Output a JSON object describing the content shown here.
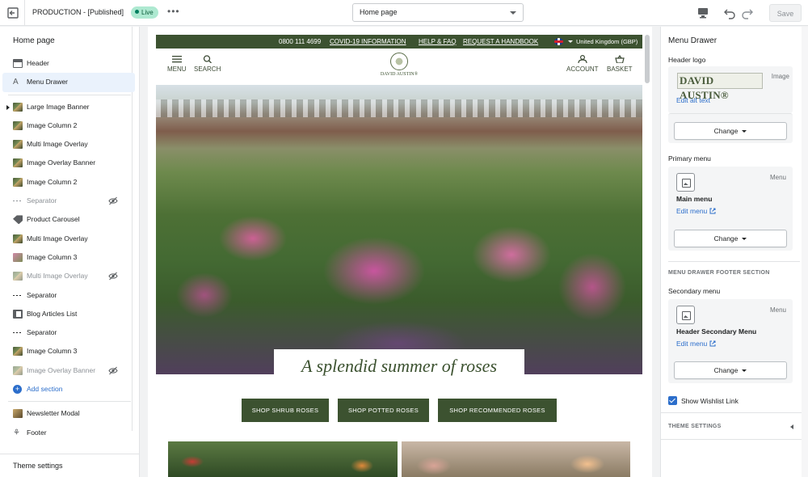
{
  "topbar": {
    "theme_title": "PRODUCTION - [Published]",
    "live_badge": "Live",
    "more": "•••",
    "page_select": "Home page",
    "save_label": "Save"
  },
  "left": {
    "title": "Home page",
    "items": [
      {
        "label": "Header"
      },
      {
        "label": "Menu Drawer"
      },
      {
        "label": "Large Image Banner"
      },
      {
        "label": "Image Column 2"
      },
      {
        "label": "Multi Image Overlay"
      },
      {
        "label": "Image Overlay Banner"
      },
      {
        "label": "Image Column 2"
      },
      {
        "label": "Separator"
      },
      {
        "label": "Product Carousel"
      },
      {
        "label": "Multi Image Overlay"
      },
      {
        "label": "Image Column 3"
      },
      {
        "label": "Multi Image Overlay"
      },
      {
        "label": "Separator"
      },
      {
        "label": "Blog Articles List"
      },
      {
        "label": "Separator"
      },
      {
        "label": "Image Column 3"
      },
      {
        "label": "Image Overlay Banner"
      }
    ],
    "add_section": "Add section",
    "bottom_items": [
      {
        "label": "Newsletter Modal"
      },
      {
        "label": "Footer"
      }
    ],
    "theme_settings": "Theme settings"
  },
  "preview": {
    "utility": {
      "phone": "0800 111 4699",
      "covid": "COVID-19 INFORMATION",
      "help": "HELP & FAQ",
      "handbook": "REQUEST A HANDBOOK",
      "region": "United Kingdom (GBP)"
    },
    "nav": {
      "menu": "MENU",
      "search": "SEARCH",
      "logo": "DAVID AUSTIN®",
      "account": "ACCOUNT",
      "basket": "BASKET"
    },
    "hero_title": "A splendid summer of roses",
    "buttons": [
      "SHOP SHRUB ROSES",
      "SHOP POTTED ROSES",
      "SHOP RECOMMENDED ROSES"
    ]
  },
  "right": {
    "title": "Menu Drawer",
    "header_logo_label": "Header logo",
    "logo_text": "DAVID AUSTIN®",
    "image_tag": "Image",
    "edit_alt": "Edit alt text",
    "change": "Change",
    "primary_menu_label": "Primary menu",
    "menu_tag": "Menu",
    "main_menu": "Main menu",
    "edit_menu": "Edit menu",
    "footer_section": "MENU DRAWER FOOTER SECTION",
    "secondary_menu_label": "Secondary menu",
    "secondary_menu": "Header Secondary Menu",
    "wishlist": "Show Wishlist Link",
    "theme_settings": "THEME SETTINGS"
  },
  "colors": {
    "brand_green": "#3c5230",
    "link_blue": "#2c6ecb",
    "live_green": "#aee9d1"
  }
}
